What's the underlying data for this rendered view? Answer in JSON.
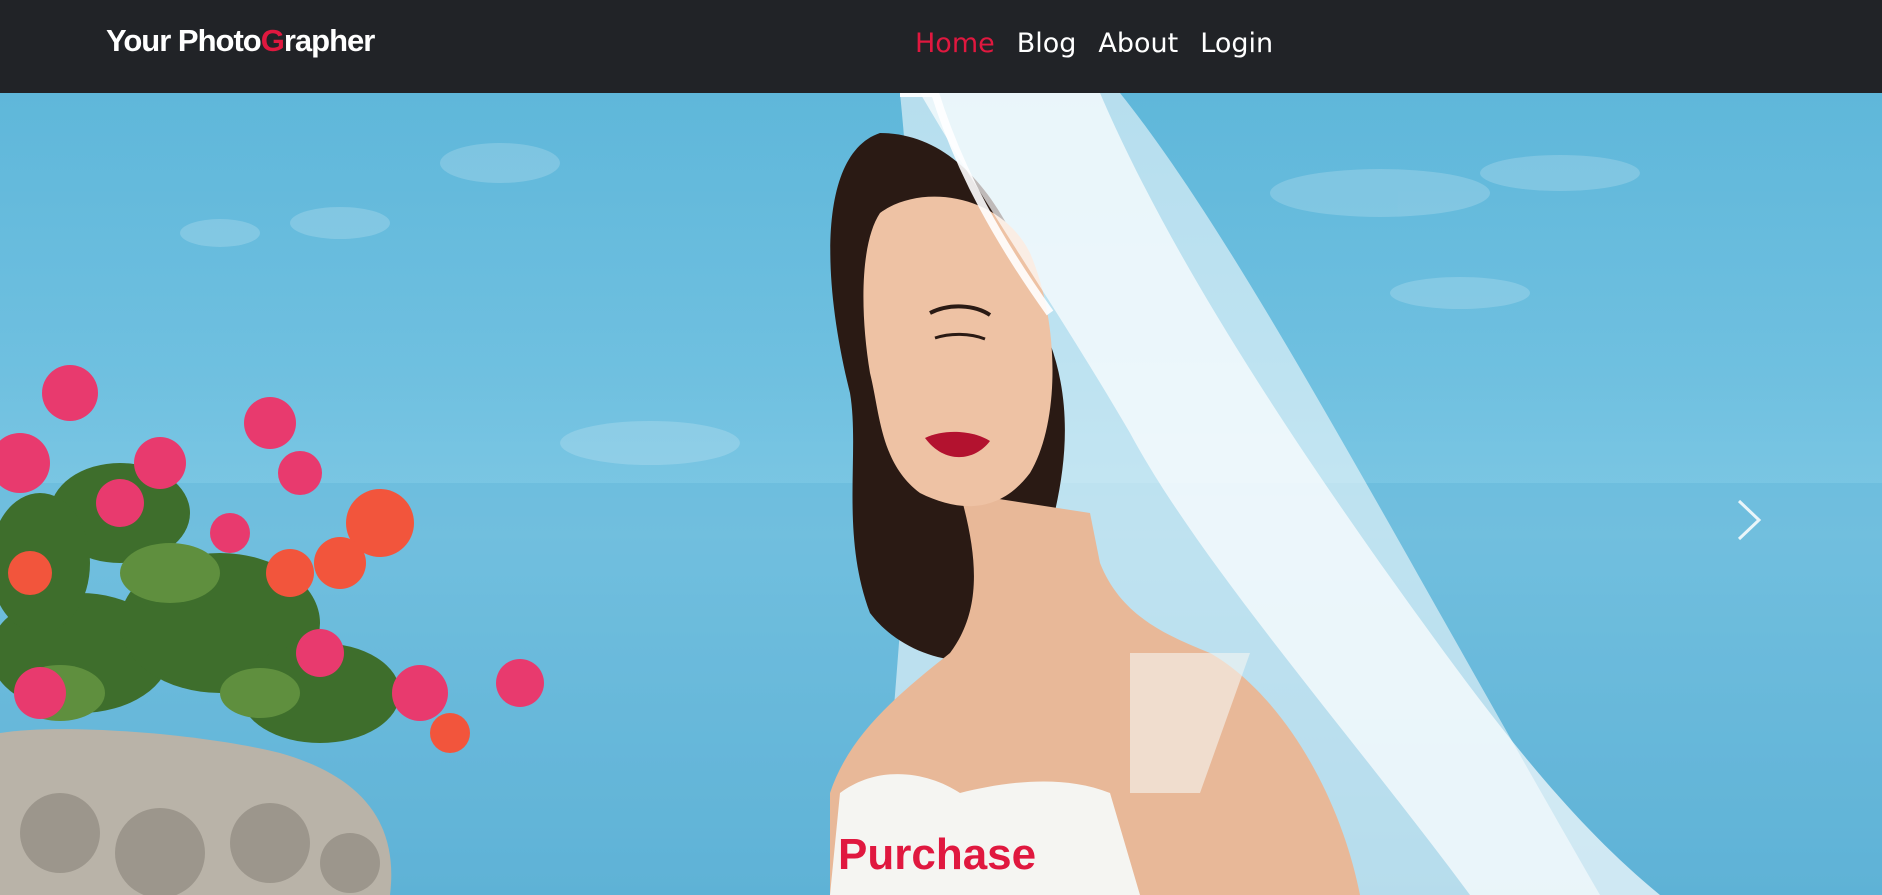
{
  "brand": {
    "prefix": "Your Photo",
    "accent_letter": "G",
    "suffix": "rapher"
  },
  "nav": {
    "items": [
      {
        "label": "Home",
        "active": true
      },
      {
        "label": "Blog",
        "active": false
      },
      {
        "label": "About",
        "active": false
      },
      {
        "label": "Login",
        "active": false
      }
    ]
  },
  "hero": {
    "next_icon": "chevron-right-icon",
    "cta_label": "Purchase"
  },
  "colors": {
    "navbar": "#212327",
    "accent": "#e0183f",
    "sky": "#6fc0e0"
  }
}
